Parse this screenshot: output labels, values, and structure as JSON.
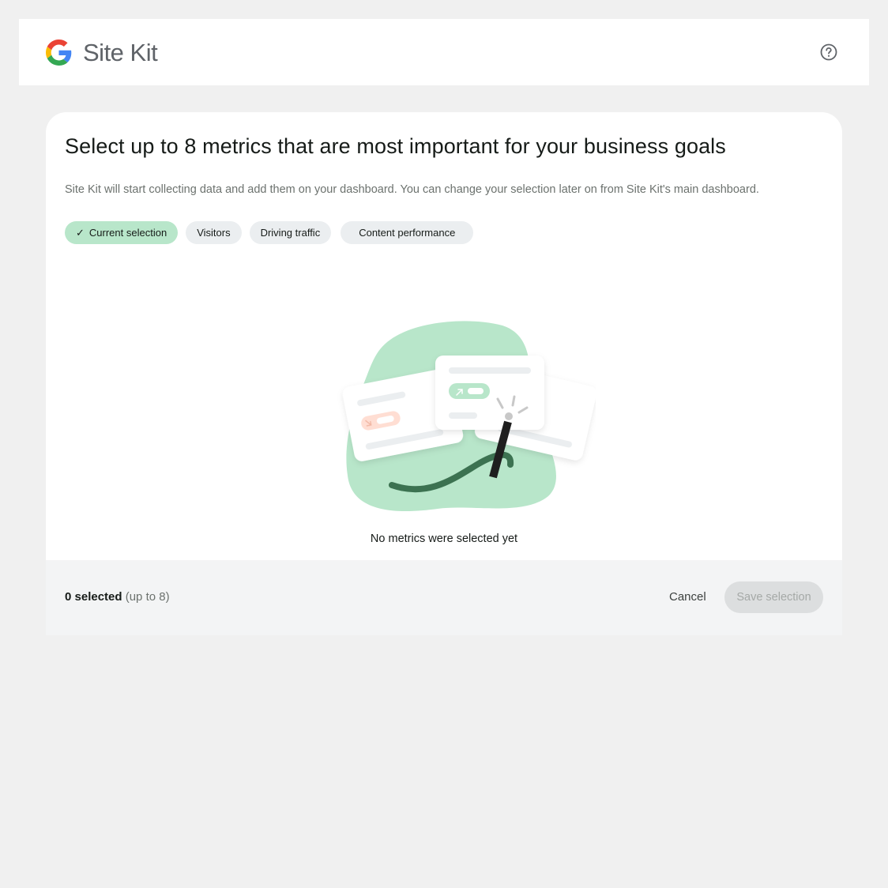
{
  "header": {
    "app_name": "Site Kit",
    "logo_icon": "google-g-icon",
    "help_icon": "help-circle-icon"
  },
  "dialog": {
    "title": "Select up to 8 metrics that are most important for your business goals",
    "description": "Site Kit will start collecting data and add them on your dashboard. You can change your selection later on from Site Kit's main dashboard.",
    "tabs": [
      {
        "label": "Current selection",
        "active": true,
        "icon": "check-icon"
      },
      {
        "label": "Visitors",
        "active": false
      },
      {
        "label": "Driving traffic",
        "active": false
      },
      {
        "label": "Content performance",
        "active": false
      }
    ],
    "empty_state": {
      "illustration": "magic-wand-metrics-illustration",
      "text": "No metrics were selected yet"
    }
  },
  "footer": {
    "selected_count": "0 selected",
    "limit_note": "(up to 8)",
    "cancel_label": "Cancel",
    "save_label": "Save selection",
    "save_disabled": true
  },
  "colors": {
    "background": "#f0f0f0",
    "active_chip": "#b8e6ca",
    "chip": "#ebeef0",
    "illustration_green": "#b8e6ca",
    "accent_dark_green": "#3c7251",
    "accent_salmon": "#ffded3"
  }
}
